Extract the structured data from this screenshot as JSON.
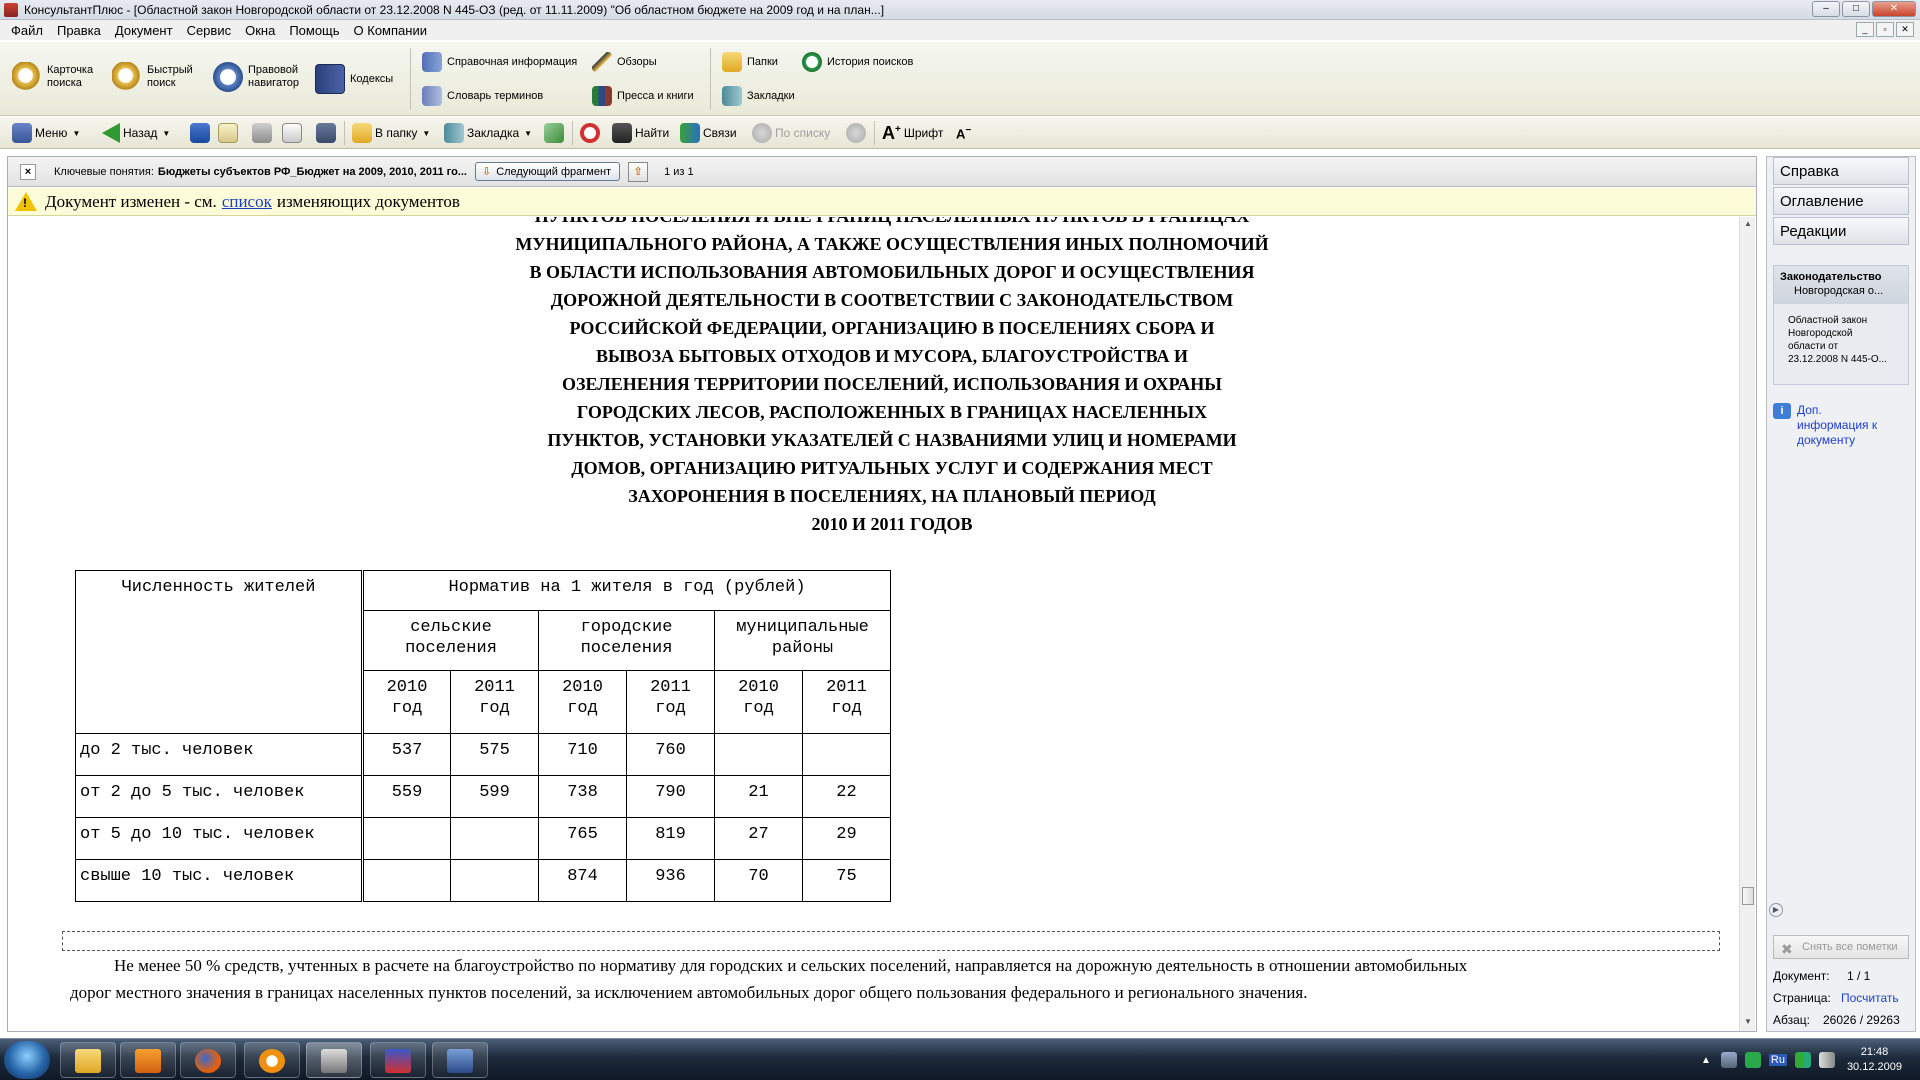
{
  "window": {
    "title": "КонсультантПлюс - [Областной закон Новгородской области от 23.12.2008 N 445-ОЗ (ред. от 11.11.2009) \"Об областном бюджете на 2009 год и на план...]",
    "min": "–",
    "max": "□",
    "close": "✕"
  },
  "menu": [
    "Файл",
    "Правка",
    "Документ",
    "Сервис",
    "Окна",
    "Помощь",
    "О Компании"
  ],
  "mdi": [
    "_",
    "▫",
    "✕"
  ],
  "bigtoolbar": {
    "card_search": "Карточка\nпоиска",
    "quick_search": "Быстрый\nпоиск",
    "legal_navigator": "Правовой\nнавигатор",
    "codes": "Кодексы",
    "reference_info": "Справочная информация",
    "glossary": "Словарь терминов",
    "reviews": "Обзоры",
    "press_books": "Пресса и книги",
    "folders": "Папки",
    "bookmarks": "Закладки",
    "search_history": "История поисков"
  },
  "smalltoolbar": {
    "menu": "Меню",
    "back": "Назад",
    "to_folder": "В папку",
    "bookmark": "Закладка",
    "find": "Найти",
    "links": "Связи",
    "by_list": "По списку",
    "font": "Шрифт"
  },
  "keybar": {
    "close": "×",
    "label": "Ключевые понятия:",
    "value": "Бюджеты субъектов РФ_Бюджет на 2009, 2010, 2011 го...",
    "next_fragment": "Следующий фрагмент",
    "up": "⇧",
    "count": "1 из 1"
  },
  "warning": {
    "icon": "!",
    "prefix": "Документ изменен - см.",
    "link": "список",
    "suffix": "изменяющих документов"
  },
  "document": {
    "heading_lines": [
      "ПУНКТОВ ПОСЕЛЕНИЯ И ВНЕ ГРАНИЦ НАСЕЛЕННЫХ ПУНКТОВ В ГРАНИЦАХ",
      "МУНИЦИПАЛЬНОГО РАЙОНА, А ТАКЖЕ ОСУЩЕСТВЛЕНИЯ ИНЫХ ПОЛНОМОЧИЙ",
      "В ОБЛАСТИ ИСПОЛЬЗОВАНИЯ АВТОМОБИЛЬНЫХ ДОРОГ И ОСУЩЕСТВЛЕНИЯ",
      "ДОРОЖНОЙ ДЕЯТЕЛЬНОСТИ В СООТВЕТСТВИИ С ЗАКОНОДАТЕЛЬСТВОМ",
      "РОССИЙСКОЙ ФЕДЕРАЦИИ, ОРГАНИЗАЦИЮ В ПОСЕЛЕНИЯХ СБОРА И",
      "ВЫВОЗА БЫТОВЫХ ОТХОДОВ И МУСОРА, БЛАГОУСТРОЙСТВА И",
      "ОЗЕЛЕНЕНИЯ ТЕРРИТОРИИ ПОСЕЛЕНИЙ, ИСПОЛЬЗОВАНИЯ И ОХРАНЫ",
      "ГОРОДСКИХ ЛЕСОВ, РАСПОЛОЖЕННЫХ В ГРАНИЦАХ НАСЕЛЕННЫХ",
      "ПУНКТОВ, УСТАНОВКИ УКАЗАТЕЛЕЙ С НАЗВАНИЯМИ УЛИЦ И НОМЕРАМИ",
      "ДОМОВ, ОРГАНИЗАЦИЮ РИТУАЛЬНЫХ УСЛУГ И СОДЕРЖАНИЯ МЕСТ",
      "ЗАХОРОНЕНИЯ В ПОСЕЛЕНИЯХ, НА ПЛАНОВЫЙ ПЕРИОД",
      "2010 И 2011 ГОДОВ"
    ],
    "table": {
      "col_population": "Численность жителей",
      "col_norm": "Норматив на 1 жителя в год (рублей)",
      "groups": [
        "сельские\nпоселения",
        "городские\nпоселения",
        "муниципальные\nрайоны"
      ],
      "years": [
        "2010\nгод",
        "2011\nгод",
        "2010\nгод",
        "2011\nгод",
        "2010\nгод",
        "2011\nгод"
      ],
      "rows": [
        {
          "label": "до 2 тыс. человек",
          "v": [
            "537",
            "575",
            "710",
            "760",
            "",
            ""
          ]
        },
        {
          "label": "от 2 до 5 тыс. человек",
          "v": [
            "559",
            "599",
            "738",
            "790",
            "21",
            "22"
          ]
        },
        {
          "label": "от 5 до 10 тыс. человек",
          "v": [
            "",
            "",
            "765",
            "819",
            "27",
            "29"
          ]
        },
        {
          "label": "свыше 10 тыс. человек",
          "v": [
            "",
            "",
            "874",
            "936",
            "70",
            "75"
          ]
        }
      ]
    },
    "paragraph_line1": "Не менее 50 % средств, учтенных в расчете на благоустройство по нормативу для городских и сельских поселений, направляется на дорожную деятельность в отношении автомобильных",
    "paragraph_line2": "дорог местного значения в границах населенных пунктов поселений, за исключением автомобильных дорог общего пользования федерального и регионального значения."
  },
  "rightpanel": {
    "tabs": [
      "Справка",
      "Оглавление",
      "Редакции"
    ],
    "card_title": "Законодательство",
    "card_sub": "Новгородская о...",
    "card_body": "Областной закон\nНовгородской\nобласти от\n23.12.2008 N 445-О...",
    "info_icon": "i",
    "info_link": "Доп.\nинформация к\nдокументу",
    "remove_marks": "Снять все пометки",
    "doc_label": "Документ:",
    "doc_value": "1 / 1",
    "page_label": "Страница:",
    "page_value": "Посчитать",
    "para_label": "Абзац:",
    "para_value": "26026 / 29263"
  },
  "taskbar": {
    "clock_time": "21:48",
    "clock_date": "30.12.2009",
    "tray_lang": "Ru",
    "tray_show_icons": "▲"
  },
  "colors": {
    "link": "#1a3fbf",
    "warning_bg": "#fdfcd8",
    "toolbar_bg": "#eeeedd",
    "taskbar": "#1d2a3b"
  }
}
